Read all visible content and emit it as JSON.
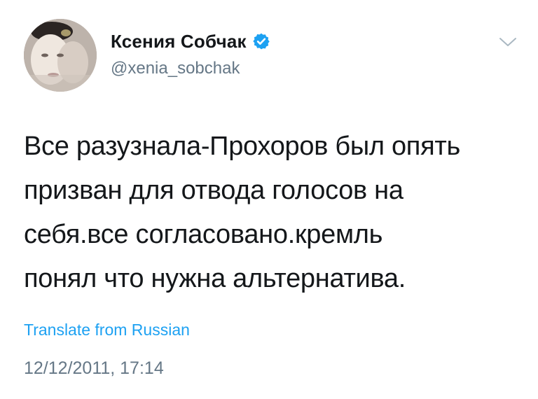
{
  "author": {
    "display_name": "Ксения Собчак",
    "handle": "@xenia_sobchak",
    "verified": true
  },
  "tweet": {
    "lines": [
      "Все разузнала-Прохоров был опять",
      "призван для отвода голосов на",
      "себя.все согласовано.кремль",
      "понял что нужна альтернатива."
    ],
    "translate_label": "Translate from Russian",
    "timestamp": "12/12/2011, 17:14"
  },
  "icons": {
    "verified": "verified-badge-icon",
    "menu": "chevron-down-icon"
  },
  "colors": {
    "text": "#14171a",
    "secondary": "#657786",
    "link": "#1da1f2",
    "verified": "#1da1f2"
  }
}
